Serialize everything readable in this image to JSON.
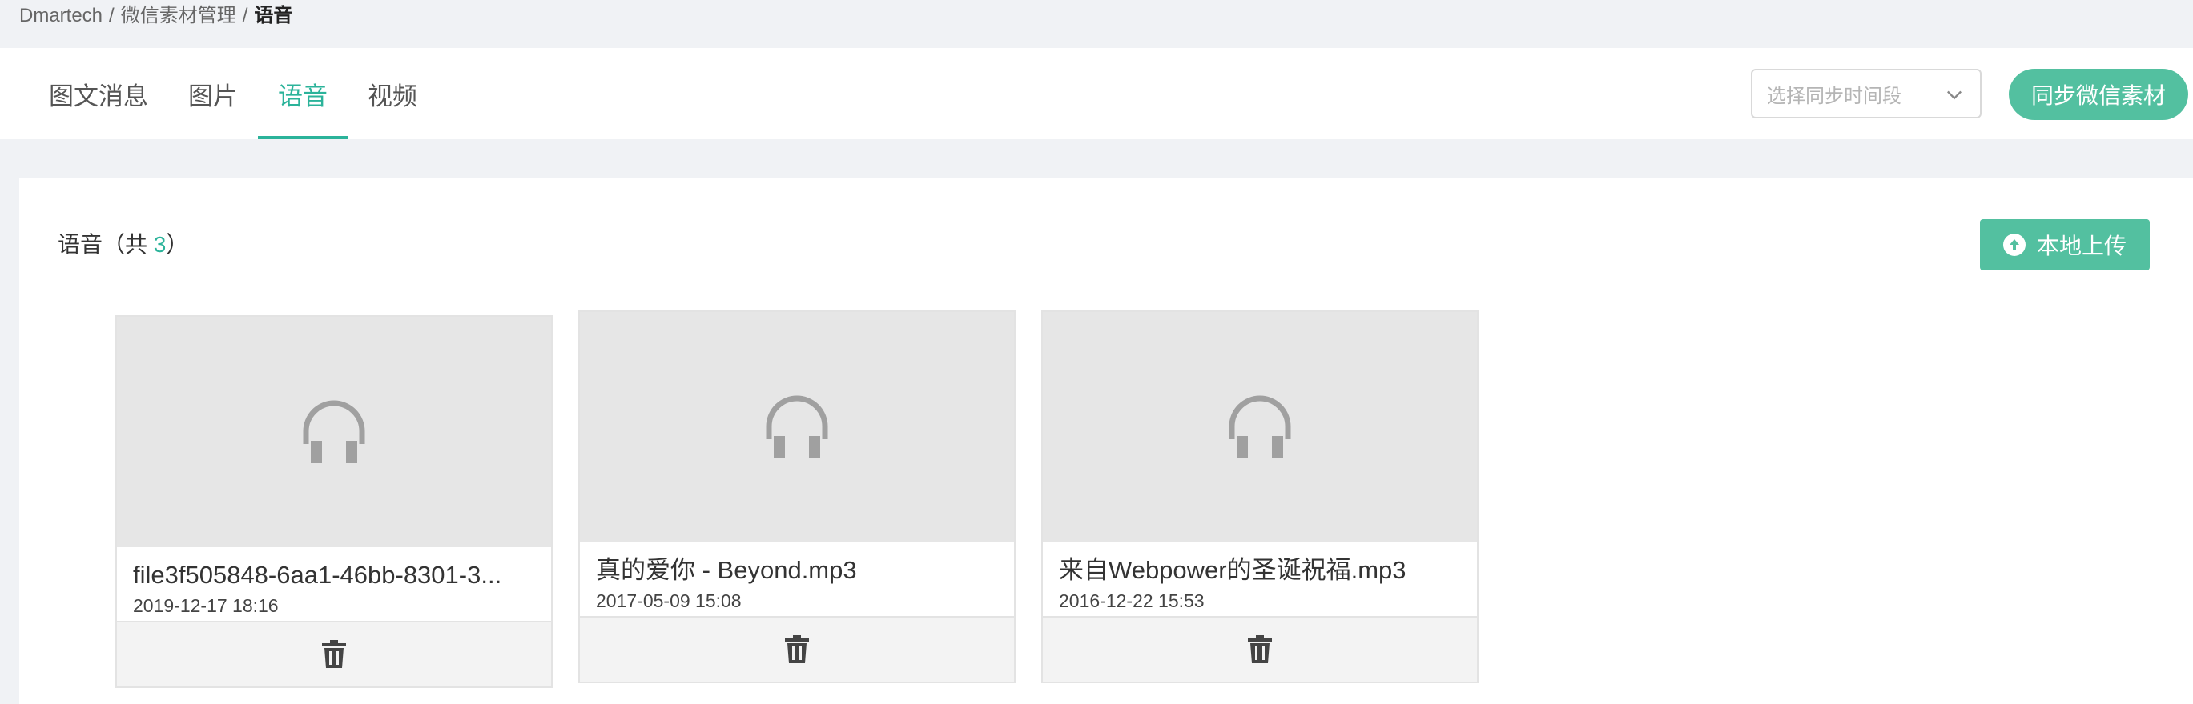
{
  "breadcrumb": {
    "root": "Dmartech",
    "parent": "微信素材管理",
    "current": "语音",
    "separator": "/"
  },
  "tabs": [
    {
      "label": "图文消息",
      "active": false
    },
    {
      "label": "图片",
      "active": false
    },
    {
      "label": "语音",
      "active": true
    },
    {
      "label": "视频",
      "active": false
    }
  ],
  "sync_select": {
    "placeholder": "选择同步时间段"
  },
  "sync_button": {
    "label": "同步微信素材"
  },
  "section": {
    "title_prefix": "语音（共 ",
    "count": "3",
    "title_suffix": "）"
  },
  "upload_button": {
    "label": "本地上传"
  },
  "files": [
    {
      "name": "file3f505848-6aa1-46bb-8301-3...",
      "date": "2019-12-17 18:16"
    },
    {
      "name": "真的爱你 - Beyond.mp3",
      "date": "2017-05-09 15:08"
    },
    {
      "name": "来自Webpower的圣诞祝福.mp3",
      "date": "2016-12-22 15:53"
    }
  ],
  "colors": {
    "accent": "#2bb39a",
    "button": "#53c0a0",
    "thumb_bg": "#e6e6e6",
    "icon": "#a0a0a0"
  },
  "icons": {
    "file_icon": "headphones-icon",
    "delete_icon": "trash-icon",
    "upload_icon": "upload-arrow-icon",
    "select_icon": "chevron-down-icon"
  }
}
